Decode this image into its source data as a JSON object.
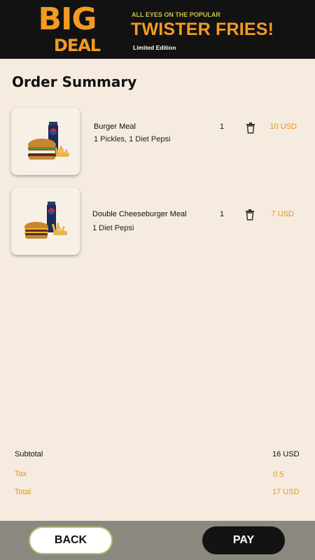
{
  "banner": {
    "big": "BIG",
    "deal": "DEAL",
    "eyebrow": "ALL EYES ON THE POPULAR",
    "headline": "TWISTER FRIES!",
    "tagline": "Limited Edition"
  },
  "page": {
    "title": "Order Summary"
  },
  "items": [
    {
      "name": "Burger Meal",
      "options": "1 Pickles, 1 Diet Pepsi",
      "quantity": "1",
      "price": "10 USD",
      "icon": "trash-icon"
    },
    {
      "name": "Double  Cheeseburger Meal",
      "options": "1 Diet Pepsi",
      "quantity": "1",
      "price": "7 USD",
      "icon": "trash-icon"
    }
  ],
  "summary": {
    "subtotal_label": "Subtotal",
    "subtotal_value": "16 USD",
    "tax_label": "Tax",
    "tax_value": "0.5",
    "total_label": "Total",
    "total_value": "17 USD"
  },
  "footer": {
    "back_label": "BACK",
    "pay_label": "PAY"
  },
  "colors": {
    "accent": "#e8951f",
    "banner_bg": "#121212",
    "page_bg": "#f5ebde",
    "footer_bg": "#8b8880"
  }
}
